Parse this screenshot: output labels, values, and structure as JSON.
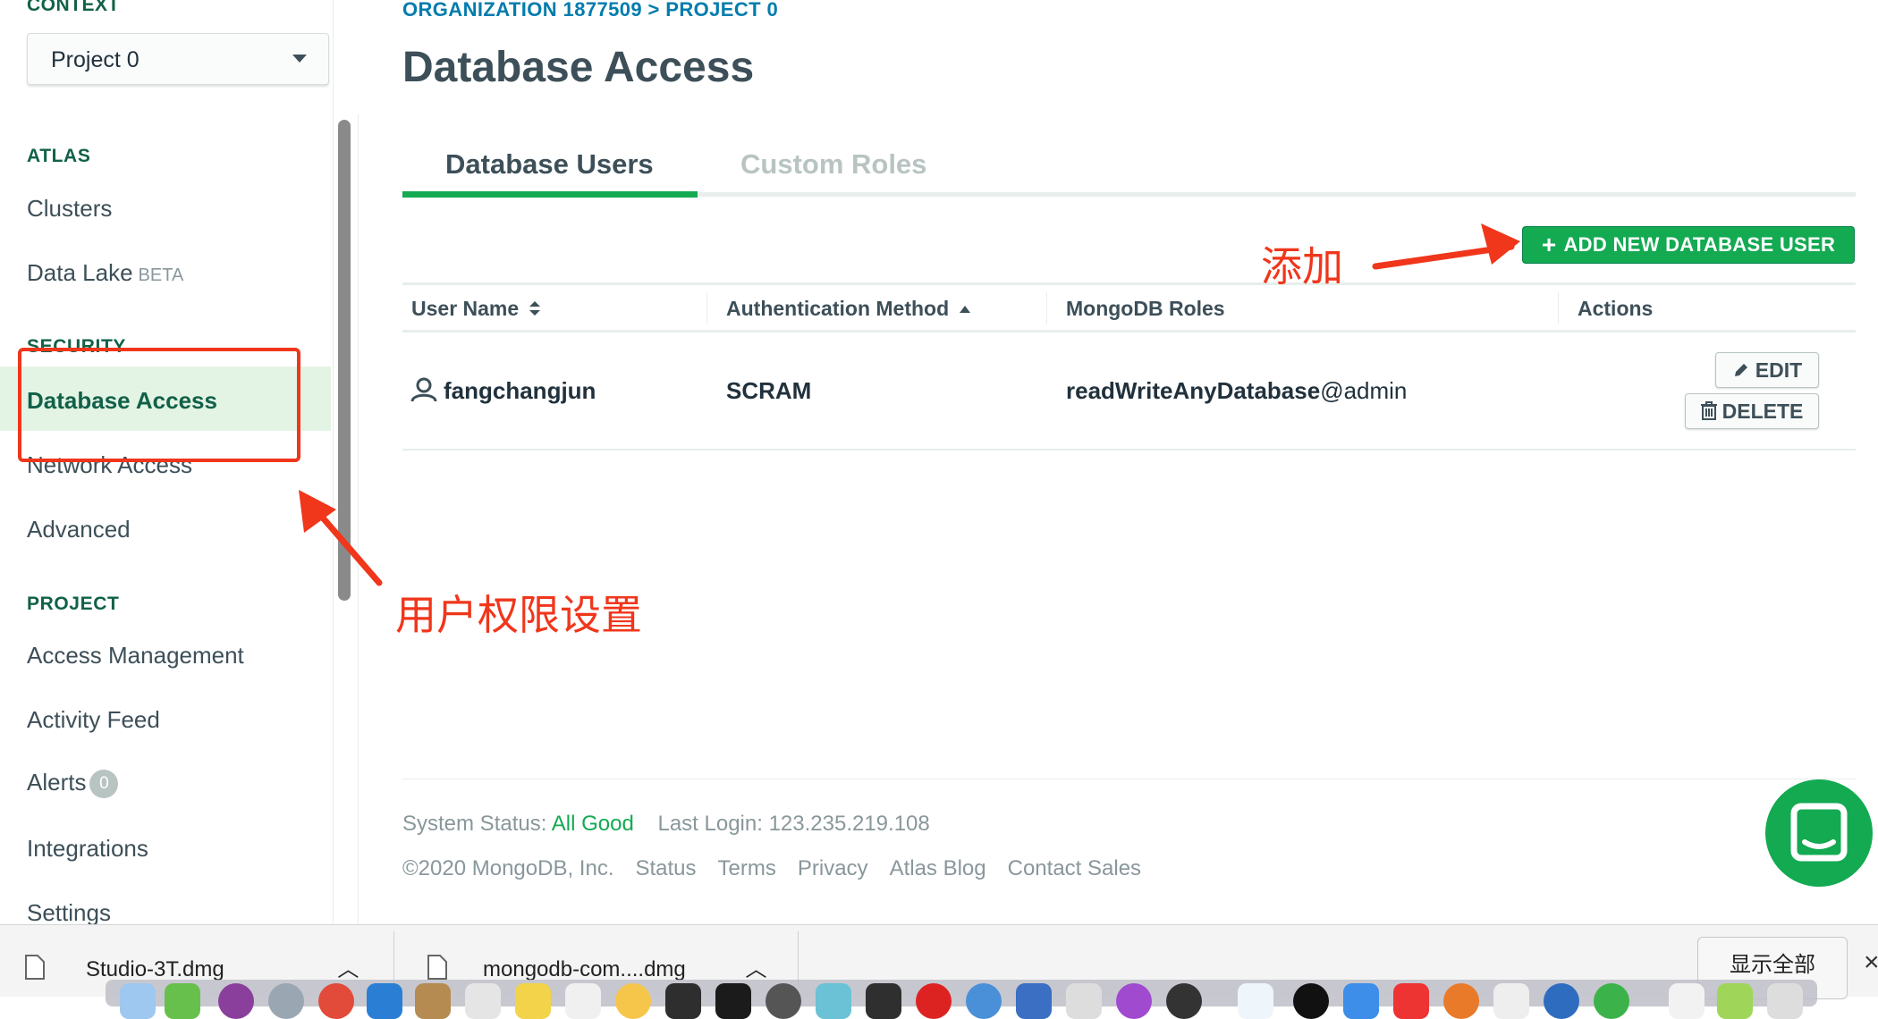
{
  "sidebar": {
    "context_label": "CONTEXT",
    "project_select": "Project 0",
    "atlas_heading": "ATLAS",
    "clusters": "Clusters",
    "data_lake": "Data Lake",
    "data_lake_badge": "BETA",
    "security_heading": "SECURITY",
    "database_access": "Database Access",
    "network_access": "Network Access",
    "advanced": "Advanced",
    "project_heading": "PROJECT",
    "access_management": "Access Management",
    "activity_feed": "Activity Feed",
    "alerts": "Alerts",
    "alerts_count": "0",
    "integrations": "Integrations",
    "settings": "Settings"
  },
  "header": {
    "breadcrumb": "ORGANIZATION 1877509 > PROJECT 0",
    "title": "Database Access"
  },
  "tabs": [
    {
      "label": "Database Users",
      "active": true
    },
    {
      "label": "Custom Roles",
      "active": false
    }
  ],
  "add_button": "ADD NEW DATABASE USER",
  "table": {
    "columns": [
      "User Name",
      "Authentication Method",
      "MongoDB Roles",
      "Actions"
    ],
    "rows": [
      {
        "user": "fangchangjun",
        "auth": "SCRAM",
        "role": "readWriteAnyDatabase",
        "role_db": "@admin",
        "edit": "EDIT",
        "delete": "DELETE"
      }
    ]
  },
  "footer": {
    "status_label": "System Status:",
    "status_value": "All Good",
    "last_login_label": "Last Login:",
    "last_login_value": "123.235.219.108",
    "copyright": "©2020 MongoDB, Inc.",
    "links": [
      "Status",
      "Terms",
      "Privacy",
      "Atlas Blog",
      "Contact Sales"
    ]
  },
  "annotations": {
    "add_note": "添加",
    "permission_note": "用户权限设置"
  },
  "downloads": {
    "items": [
      "Studio-3T.dmg",
      "mongodb-com....dmg"
    ],
    "show_all": "显示全部"
  },
  "colors": {
    "brand_green": "#13aa52",
    "annotation_red": "#f0361b",
    "link_blue": "#007cad"
  }
}
